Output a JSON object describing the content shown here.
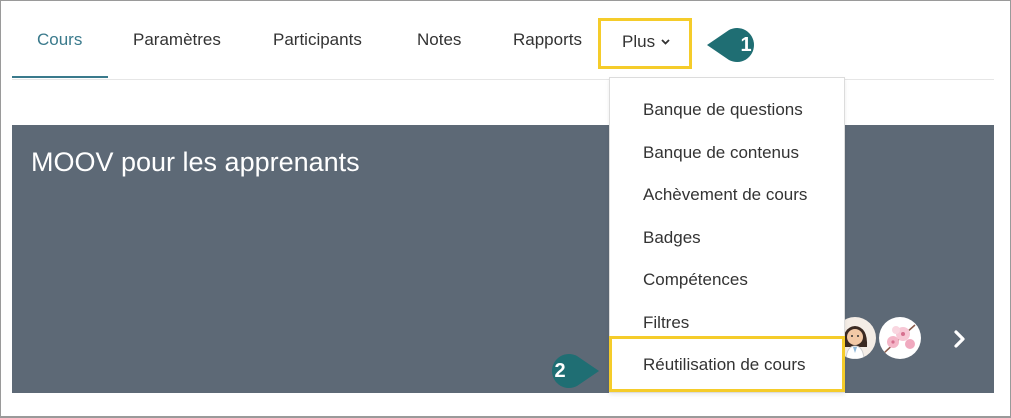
{
  "tabs": [
    {
      "label": "Cours",
      "active": true
    },
    {
      "label": "Paramètres",
      "active": false
    },
    {
      "label": "Participants",
      "active": false
    },
    {
      "label": "Notes",
      "active": false
    },
    {
      "label": "Rapports",
      "active": false
    },
    {
      "label": "Plus",
      "active": false,
      "icon": "chevron-down-icon"
    }
  ],
  "callouts": {
    "one": "1",
    "two": "2"
  },
  "banner": {
    "title": "MOOV pour les apprenants",
    "avatars": [
      "avatar-doctor-icon",
      "avatar-blossom-icon"
    ],
    "next_icon": "chevron-right-icon"
  },
  "dropdown": {
    "items": [
      "Banque de questions",
      "Banque de contenus",
      "Achèvement de cours",
      "Badges",
      "Compétences",
      "Filtres",
      "Réutilisation de cours"
    ]
  },
  "colors": {
    "accent": "#3a7a8c",
    "highlight": "#f5cc2a",
    "banner": "#5d6976",
    "callout": "#1f6e73"
  }
}
